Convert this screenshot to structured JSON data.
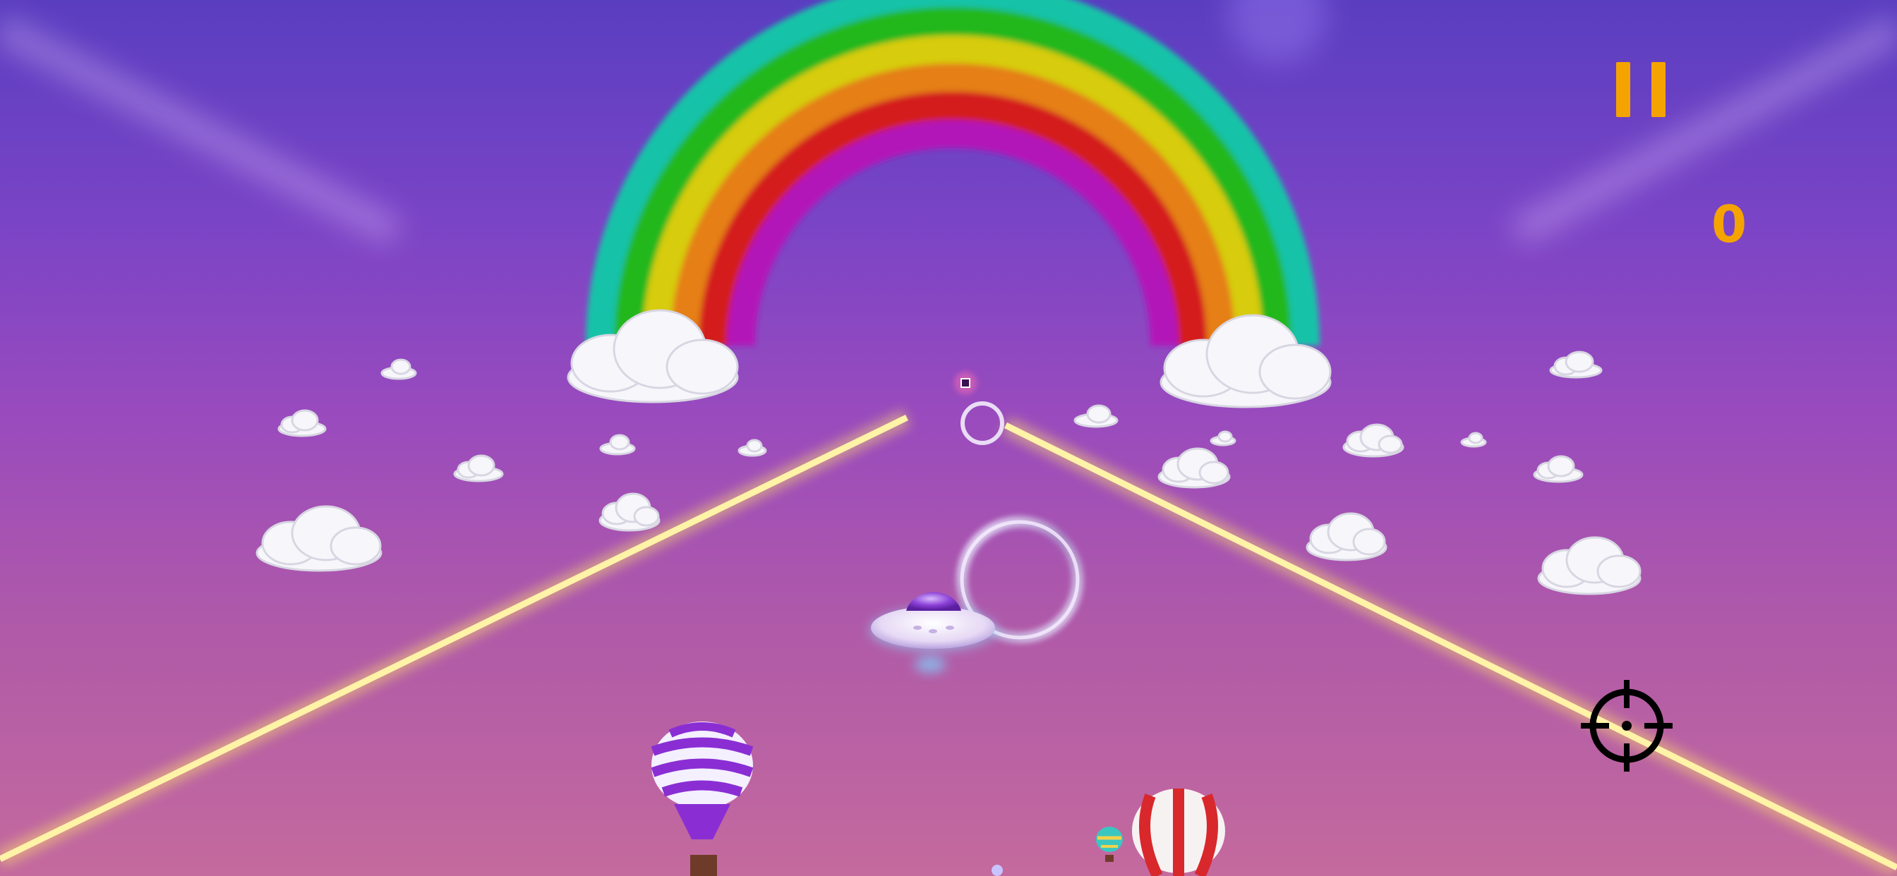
{
  "hud": {
    "score": "0",
    "pause_icon": "pause-icon",
    "crosshair_icon": "crosshair-icon"
  },
  "colors": {
    "hud_accent": "#f5a300",
    "sky_top": "#5a3ec0",
    "sky_bottom": "#c46a9e",
    "track_glow": "#ffe36a"
  },
  "scene": {
    "player": "ufo",
    "track": "glowing-rails",
    "rings_visible": 2,
    "background_objects": [
      "rainbow",
      "clouds",
      "hot-air-balloons"
    ]
  }
}
